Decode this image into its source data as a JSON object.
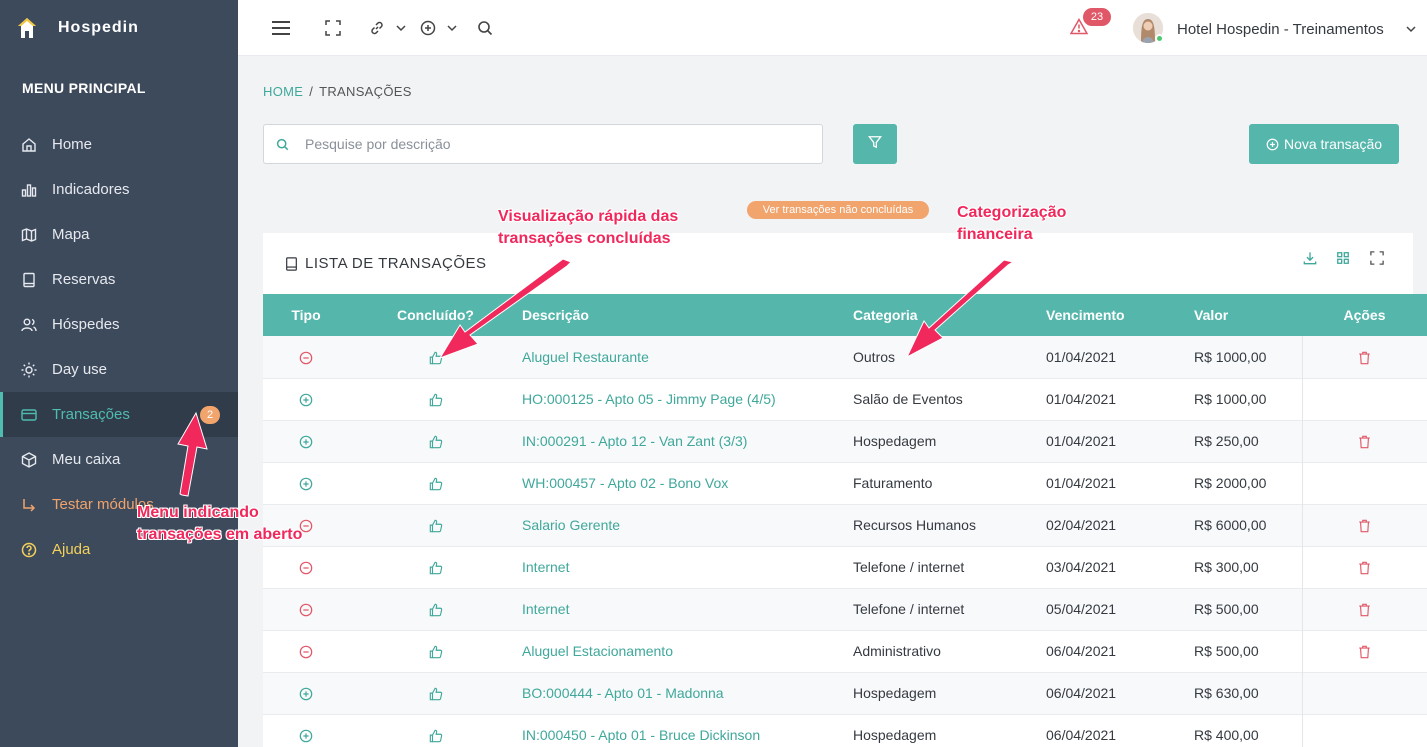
{
  "brand": {
    "name": "Hospedin"
  },
  "sidebar": {
    "title": "MENU PRINCIPAL",
    "items": [
      {
        "label": "Home",
        "icon": "home-icon"
      },
      {
        "label": "Indicadores",
        "icon": "bar-chart-icon"
      },
      {
        "label": "Mapa",
        "icon": "map-icon"
      },
      {
        "label": "Reservas",
        "icon": "book-icon"
      },
      {
        "label": "Hóspedes",
        "icon": "users-icon"
      },
      {
        "label": "Day use",
        "icon": "sun-icon"
      },
      {
        "label": "Transações",
        "icon": "credit-card-icon",
        "badge": "2",
        "active": true
      },
      {
        "label": "Meu caixa",
        "icon": "box-icon"
      },
      {
        "label": "Testar módulos",
        "icon": "corner-arrow-icon"
      },
      {
        "label": "Ajuda",
        "icon": "help-circle-icon"
      }
    ]
  },
  "topbar": {
    "alert_count": "23",
    "hotel_name": "Hotel Hospedin - Treinamentos"
  },
  "breadcrumb": {
    "home": "HOME",
    "separator": "/",
    "current": "TRANSAÇÕES"
  },
  "search": {
    "placeholder": "Pesquise por descrição",
    "value": ""
  },
  "new_button": {
    "label": "Nova transação"
  },
  "pending_pill": {
    "label": "Ver transações não concluídas"
  },
  "card": {
    "title": "LISTA DE TRANSAÇÕES"
  },
  "table": {
    "headers": {
      "tipo": "Tipo",
      "concluido": "Concluído?",
      "descricao": "Descrição",
      "categoria": "Categoria",
      "vencimento": "Vencimento",
      "valor": "Valor",
      "acoes": "Ações"
    },
    "rows": [
      {
        "tipo": "saida",
        "descricao": "Aluguel Restaurante",
        "categoria": "Outros",
        "vencimento": "01/04/2021",
        "valor": "R$ 1000,00",
        "delete": true
      },
      {
        "tipo": "entrada",
        "descricao": "HO:000125 - Apto 05 - Jimmy Page (4/5)",
        "categoria": "Salão de Eventos",
        "vencimento": "01/04/2021",
        "valor": "R$ 1000,00",
        "delete": false
      },
      {
        "tipo": "entrada",
        "descricao": "IN:000291 - Apto 12 - Van Zant (3/3)",
        "categoria": "Hospedagem",
        "vencimento": "01/04/2021",
        "valor": "R$ 250,00",
        "delete": true
      },
      {
        "tipo": "entrada",
        "descricao": "WH:000457 - Apto 02 - Bono Vox",
        "categoria": "Faturamento",
        "vencimento": "01/04/2021",
        "valor": "R$ 2000,00",
        "delete": false
      },
      {
        "tipo": "saida",
        "descricao": "Salario Gerente",
        "categoria": "Recursos Humanos",
        "vencimento": "02/04/2021",
        "valor": "R$ 6000,00",
        "delete": true
      },
      {
        "tipo": "saida",
        "descricao": "Internet",
        "categoria": "Telefone / internet",
        "vencimento": "03/04/2021",
        "valor": "R$ 300,00",
        "delete": true
      },
      {
        "tipo": "saida",
        "descricao": "Internet",
        "categoria": "Telefone / internet",
        "vencimento": "05/04/2021",
        "valor": "R$ 500,00",
        "delete": true
      },
      {
        "tipo": "saida",
        "descricao": "Aluguel Estacionamento",
        "categoria": "Administrativo",
        "vencimento": "06/04/2021",
        "valor": "R$ 500,00",
        "delete": true
      },
      {
        "tipo": "entrada",
        "descricao": "BO:000444 - Apto 01 - Madonna",
        "categoria": "Hospedagem",
        "vencimento": "06/04/2021",
        "valor": "R$ 630,00",
        "delete": false
      },
      {
        "tipo": "entrada",
        "descricao": "IN:000450 - Apto 01 - Bruce Dickinson",
        "categoria": "Hospedagem",
        "vencimento": "06/04/2021",
        "valor": "R$ 400,00",
        "delete": false
      }
    ]
  },
  "annotations": {
    "quick_view": [
      "Visualização rápida das",
      "transações concluídas"
    ],
    "category": [
      "Categorização",
      "financeira"
    ],
    "menu": [
      "Menu indicando",
      "transações em aberto"
    ]
  },
  "colors": {
    "sidebar_bg": "#3d4a5c",
    "accent": "#55b6ab",
    "accent_text": "#3fa89b",
    "badge_orange": "#f2a46d",
    "alert_red": "#e05767",
    "annotation_pink": "#f0285c"
  }
}
